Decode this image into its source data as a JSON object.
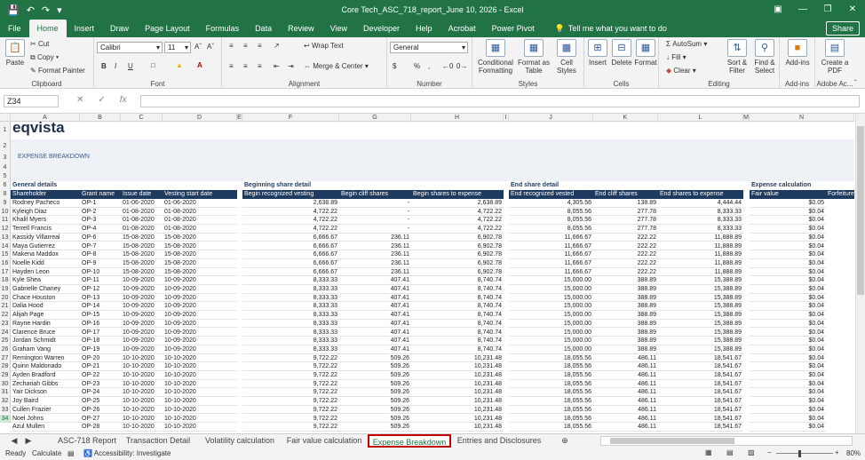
{
  "window": {
    "title": "Core Tech_ASC_718_report_June 10, 2026  -  Excel"
  },
  "ribbon_tabs": [
    "File",
    "Home",
    "Insert",
    "Draw",
    "Page Layout",
    "Formulas",
    "Data",
    "Review",
    "View",
    "Developer",
    "Help",
    "Acrobat",
    "Power Pivot"
  ],
  "tell_me": "Tell me what you want to do",
  "share": "Share",
  "clipboard": {
    "paste": "Paste",
    "cut": "Cut",
    "copy": "Copy",
    "format_painter": "Format Painter",
    "label": "Clipboard"
  },
  "font": {
    "name": "Calibri",
    "size": "11",
    "label": "Font",
    "bold": "B",
    "italic": "I",
    "underline": "U"
  },
  "alignment": {
    "wrap": "Wrap Text",
    "merge": "Merge & Center",
    "label": "Alignment"
  },
  "number": {
    "format": "General",
    "label": "Number",
    "currency": "$",
    "percent": "%",
    "comma": ","
  },
  "styles": {
    "cond": "Conditional Formatting",
    "table": "Format as Table",
    "cell": "Cell Styles",
    "label": "Styles"
  },
  "cells": {
    "insert": "Insert",
    "delete": "Delete",
    "format": "Format",
    "label": "Cells"
  },
  "editing": {
    "autosum": "AutoSum",
    "fill": "Fill",
    "clear": "Clear",
    "sort": "Sort & Filter",
    "find": "Find & Select",
    "label": "Editing"
  },
  "addins": {
    "addins": "Add-ins",
    "label": "Add-ins"
  },
  "adobe": {
    "pdf": "Create a PDF",
    "label": "Adobe Ac..."
  },
  "name_box": "Z34",
  "fx": "fx",
  "columns": [
    "A",
    "B",
    "C",
    "D",
    "E",
    "F",
    "G",
    "H",
    "I",
    "J",
    "K",
    "L",
    "M",
    "N"
  ],
  "sheet": {
    "logo": "eqvista",
    "title": "EXPENSE BREAKDOWN",
    "sections": {
      "general": "General details",
      "begin": "Beginning share  detail",
      "end": "End share detail",
      "expense": "Expense calculation"
    },
    "headers": [
      "Shareholder",
      "Grant name",
      "Issue date",
      "Vesting start date",
      "Begin recognized vesting",
      "Begin cliff shares",
      "Begin shares to expense",
      "End recognized vested",
      "End cliff shares",
      "End shares to expense",
      "Fair value",
      "Forfeiture"
    ],
    "rows": [
      [
        "Rodney Pacheco",
        "OP-1",
        "01-06-2020",
        "01-06-2020",
        "2,638.89",
        "-",
        "2,638.89",
        "4,305.56",
        "138.89",
        "4,444.44",
        "$0.05"
      ],
      [
        "Kyleigh Diaz",
        "OP-2",
        "01-08-2020",
        "01-08-2020",
        "4,722.22",
        "-",
        "4,722.22",
        "8,055.56",
        "277.78",
        "8,333.33",
        "$0.04"
      ],
      [
        "Khalil Myers",
        "OP-3",
        "01-08-2020",
        "01-08-2020",
        "4,722.22",
        "-",
        "4,722.22",
        "8,055.56",
        "277.78",
        "8,333.33",
        "$0.04"
      ],
      [
        "Terrell Francis",
        "OP-4",
        "01-08-2020",
        "01-08-2020",
        "4,722.22",
        "-",
        "4,722.22",
        "8,055.56",
        "277.78",
        "8,333.33",
        "$0.04"
      ],
      [
        "Kassidy Villarreal",
        "OP-6",
        "15-08-2020",
        "15-08-2020",
        "6,666.67",
        "236.11",
        "6,902.78",
        "11,666.67",
        "222.22",
        "11,888.89",
        "$0.04"
      ],
      [
        "Maya Gutierrez",
        "OP-7",
        "15-08-2020",
        "15-08-2020",
        "6,666.67",
        "236.11",
        "6,902.78",
        "11,666.67",
        "222.22",
        "11,888.89",
        "$0.04"
      ],
      [
        "Makena Maddox",
        "OP-8",
        "15-08-2020",
        "15-08-2020",
        "6,666.67",
        "236.11",
        "6,902.78",
        "11,666.67",
        "222.22",
        "11,888.89",
        "$0.04"
      ],
      [
        "Noelle Kidd",
        "OP-9",
        "15-08-2020",
        "15-08-2020",
        "6,666.67",
        "236.11",
        "6,902.78",
        "11,666.67",
        "222.22",
        "11,888.89",
        "$0.04"
      ],
      [
        "Hayden Leon",
        "OP-10",
        "15-08-2020",
        "15-08-2020",
        "6,666.67",
        "236.11",
        "6,902.78",
        "11,666.67",
        "222.22",
        "11,888.89",
        "$0.04"
      ],
      [
        "Kyle Shea",
        "OP-11",
        "10-09-2020",
        "10-09-2020",
        "8,333.33",
        "407.41",
        "8,740.74",
        "15,000.00",
        "388.89",
        "15,388.89",
        "$0.04"
      ],
      [
        "Gabrielle Chaney",
        "OP-12",
        "10-09-2020",
        "10-09-2020",
        "8,333.33",
        "407.41",
        "8,740.74",
        "15,000.00",
        "388.89",
        "15,388.89",
        "$0.04"
      ],
      [
        "Chace Houston",
        "OP-13",
        "10-09-2020",
        "10-09-2020",
        "8,333.33",
        "407.41",
        "8,740.74",
        "15,000.00",
        "388.89",
        "15,388.89",
        "$0.04"
      ],
      [
        "Dalia Hood",
        "OP-14",
        "10-09-2020",
        "10-09-2020",
        "8,333.33",
        "407.41",
        "8,740.74",
        "15,000.00",
        "388.89",
        "15,388.89",
        "$0.04"
      ],
      [
        "Alijah Page",
        "OP-15",
        "10-09-2020",
        "10-09-2020",
        "8,333.33",
        "407.41",
        "8,740.74",
        "15,000.00",
        "388.89",
        "15,388.89",
        "$0.04"
      ],
      [
        "Rayne Hardin",
        "OP-16",
        "10-09-2020",
        "10-09-2020",
        "8,333.33",
        "407.41",
        "8,740.74",
        "15,000.00",
        "388.89",
        "15,388.89",
        "$0.04"
      ],
      [
        "Clarence Bruce",
        "OP-17",
        "10-09-2020",
        "10-09-2020",
        "8,333.33",
        "407.41",
        "8,740.74",
        "15,000.00",
        "388.89",
        "15,388.89",
        "$0.04"
      ],
      [
        "Jordan Schmidt",
        "OP-18",
        "10-09-2020",
        "10-09-2020",
        "8,333.33",
        "407.41",
        "8,740.74",
        "15,000.00",
        "388.89",
        "15,388.89",
        "$0.04"
      ],
      [
        "Graham Vang",
        "OP-19",
        "10-09-2020",
        "10-09-2020",
        "8,333.33",
        "407.41",
        "8,740.74",
        "15,000.00",
        "388.89",
        "15,388.89",
        "$0.04"
      ],
      [
        "Remington Warren",
        "OP-20",
        "10-10-2020",
        "10-10-2020",
        "9,722.22",
        "509.26",
        "10,231.48",
        "18,055.56",
        "486.11",
        "18,541.67",
        "$0.04"
      ],
      [
        "Quinn Maldonado",
        "OP-21",
        "10-10-2020",
        "10-10-2020",
        "9,722.22",
        "509.26",
        "10,231.48",
        "18,055.56",
        "486.11",
        "18,541.67",
        "$0.04"
      ],
      [
        "Ayden Bradford",
        "OP-22",
        "10-10-2020",
        "10-10-2020",
        "9,722.22",
        "509.26",
        "10,231.48",
        "18,055.56",
        "486.11",
        "18,541.67",
        "$0.04"
      ],
      [
        "Zechariah Gibbs",
        "OP-23",
        "10-10-2020",
        "10-10-2020",
        "9,722.22",
        "509.26",
        "10,231.48",
        "18,055.56",
        "486.11",
        "18,541.67",
        "$0.04"
      ],
      [
        "Yair Dickson",
        "OP-24",
        "10-10-2020",
        "10-10-2020",
        "9,722.22",
        "509.26",
        "10,231.48",
        "18,055.56",
        "486.11",
        "18,541.67",
        "$0.04"
      ],
      [
        "Joy Baird",
        "OP-25",
        "10-10-2020",
        "10-10-2020",
        "9,722.22",
        "509.26",
        "10,231.48",
        "18,055.56",
        "486.11",
        "18,541.67",
        "$0.04"
      ],
      [
        "Cullen Frazier",
        "OP-26",
        "10-10-2020",
        "10-10-2020",
        "9,722.22",
        "509.26",
        "10,231.48",
        "18,055.56",
        "486.11",
        "18,541.67",
        "$0.04"
      ],
      [
        "Noel Johns",
        "OP-27",
        "10-10-2020",
        "10-10-2020",
        "9,722.22",
        "509.26",
        "10,231.48",
        "18,055.56",
        "486.11",
        "18,541.67",
        "$0.04"
      ],
      [
        "Azul Mullen",
        "OP-28",
        "10-10-2020",
        "10-10-2020",
        "9,722.22",
        "509.26",
        "10,231.48",
        "18,055.56",
        "486.11",
        "18,541.67",
        "$0.04"
      ]
    ]
  },
  "row_numbers": [
    "1",
    "2",
    "3",
    "4",
    "5",
    "6",
    "8",
    "9",
    "10",
    "11",
    "12",
    "13",
    "14",
    "15",
    "16",
    "17",
    "18",
    "19",
    "20",
    "21",
    "22",
    "23",
    "24",
    "25",
    "26",
    "27",
    "28",
    "29",
    "30",
    "31",
    "32",
    "33",
    "34"
  ],
  "sheet_tabs": [
    "ASC-718 Report",
    "Transaction Detail",
    "Volatility calculation",
    "Fair value calculation",
    "Expense Breakdown",
    "Entries and Disclosures"
  ],
  "active_sheet": "Expense Breakdown",
  "status": {
    "ready": "Ready",
    "calculate": "Calculate",
    "accessibility": "Accessibility: Investigate",
    "zoom": "80%"
  },
  "colors": {
    "excel_green": "#217346",
    "header_navy": "#1f3a5f",
    "active_tab_border": "#c00000"
  }
}
